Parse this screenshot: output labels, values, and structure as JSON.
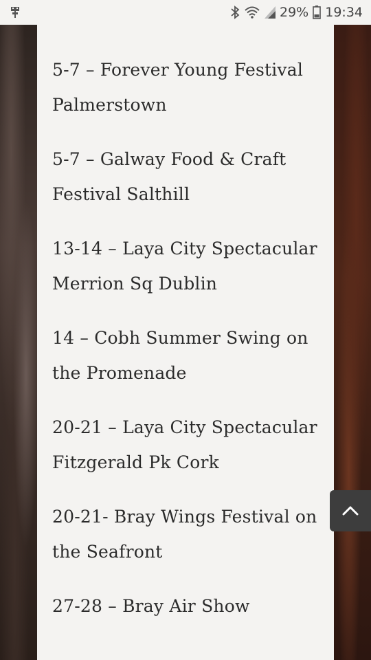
{
  "status_bar": {
    "battery_percent": "29%",
    "time": "19:34",
    "icons": [
      "usb-icon",
      "bluetooth-icon",
      "wifi-icon",
      "signal-icon",
      "battery-icon"
    ]
  },
  "events": [
    {
      "text": "5-7 – Forever Young Festival Palmerstown"
    },
    {
      "text": "5-7 – Galway Food & Craft Festival Salthill"
    },
    {
      "text": "13-14 – Laya City Spectacular Merrion Sq Dublin"
    },
    {
      "text": "14 – Cobh Summer Swing on the Promenade"
    },
    {
      "text": "20-21 – Laya City Spectacular Fitzgerald Pk Cork"
    },
    {
      "text": "20-21- Bray Wings Festival on the Seafront"
    },
    {
      "text": "27-28 – Bray Air Show"
    }
  ],
  "colors": {
    "content_bg": "#f4f3f1",
    "text": "#2b2b2b",
    "scroll_button": "#3d3d3d"
  },
  "scroll_top_icon": "chevron-up-icon"
}
